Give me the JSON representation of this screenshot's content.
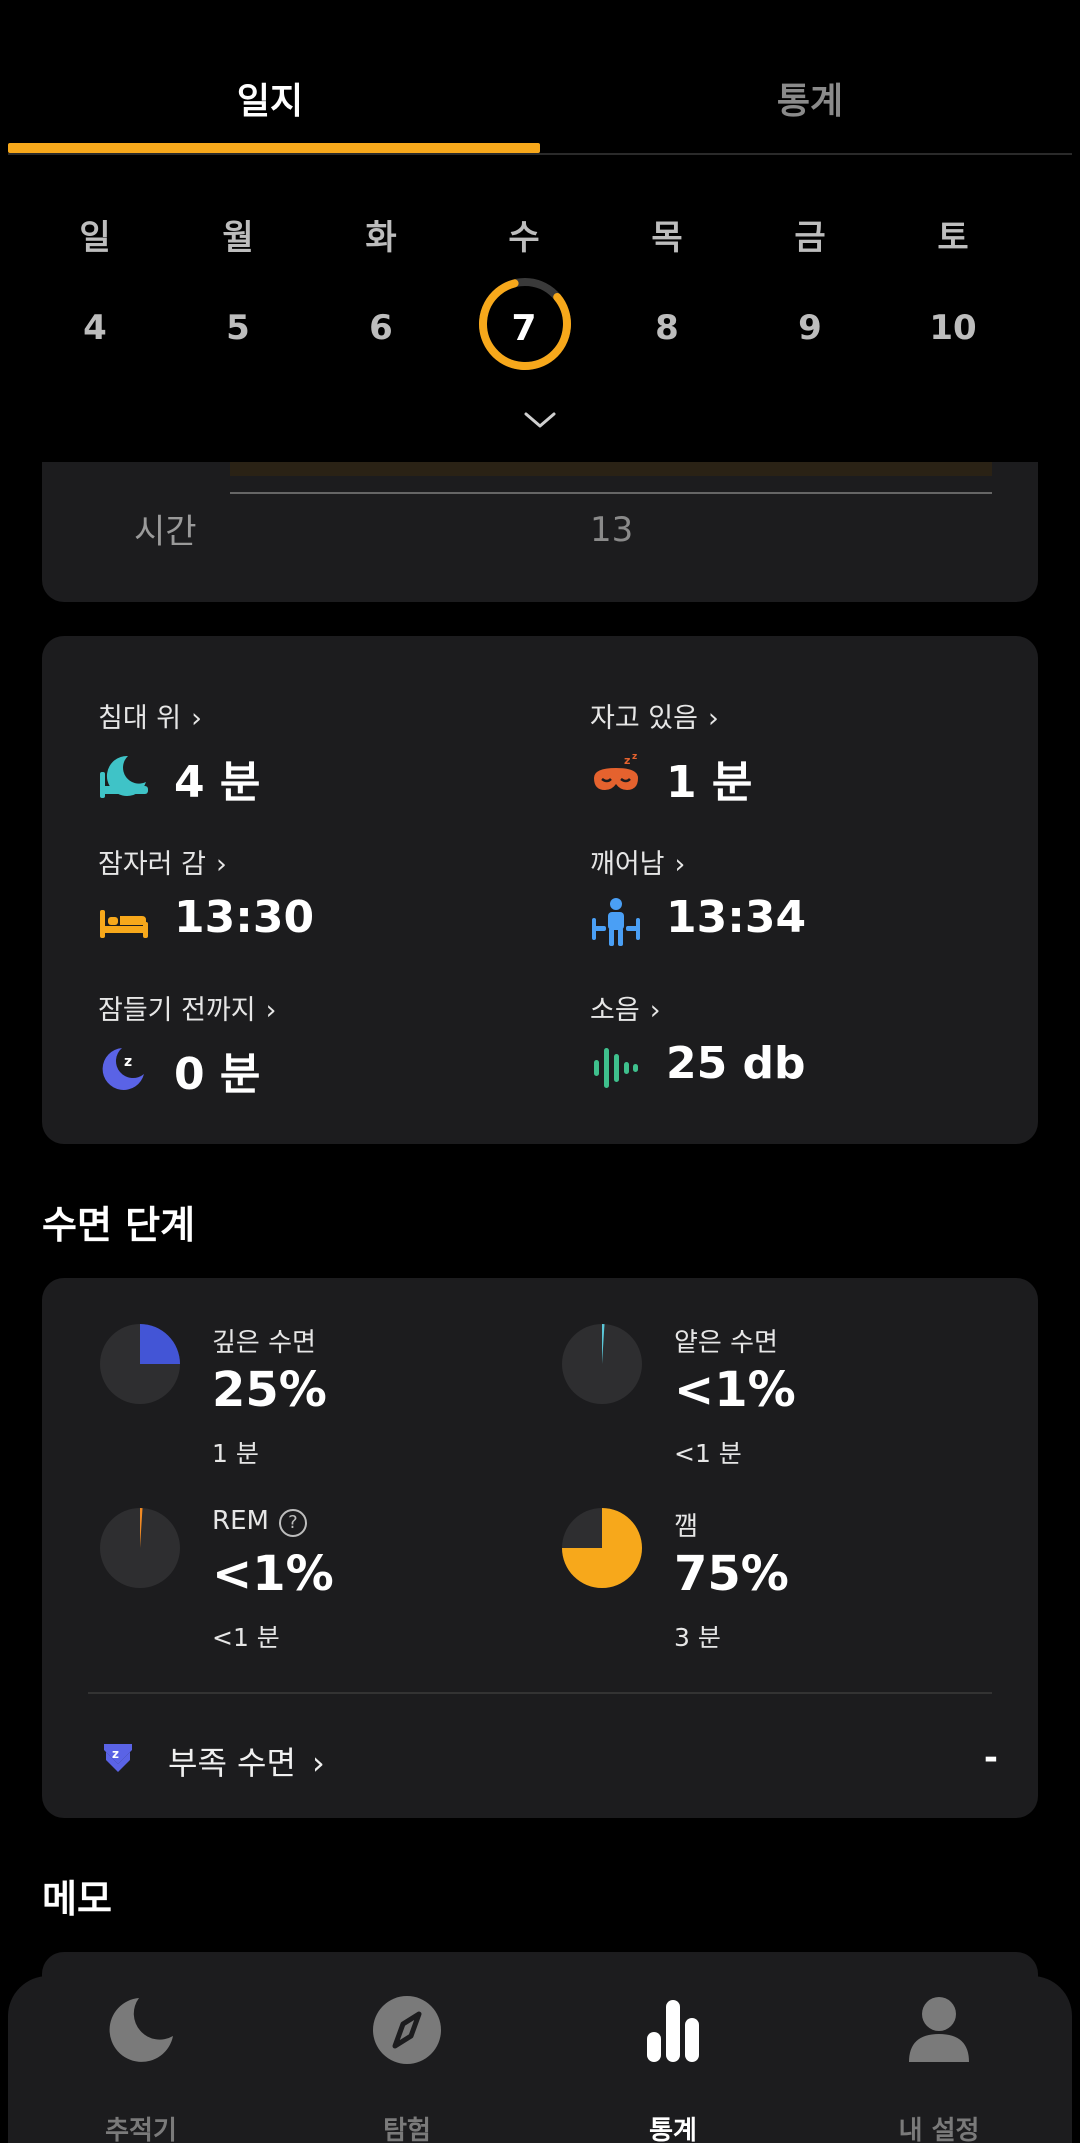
{
  "tabs": {
    "journal": "일지",
    "stats": "통계"
  },
  "week": {
    "days": [
      "일",
      "월",
      "화",
      "수",
      "목",
      "금",
      "토"
    ],
    "dates": [
      "4",
      "5",
      "6",
      "7",
      "8",
      "9",
      "10"
    ],
    "selected_index": 3,
    "selected_progress": 0.82
  },
  "timeline": {
    "label": "시간",
    "tick": "13"
  },
  "metrics": {
    "in_bed": {
      "label": "침대 위",
      "value": "4 분"
    },
    "asleep": {
      "label": "자고 있음",
      "value": "1 분"
    },
    "went_to_bed": {
      "label": "잠자러 감",
      "value": "13:30"
    },
    "woke_up": {
      "label": "깨어남",
      "value": "13:34"
    },
    "to_fall_asleep": {
      "label": "잠들기 전까지",
      "value": "0 분"
    },
    "noise": {
      "label": "소음",
      "value": "25 db"
    },
    "arrow": "›"
  },
  "stages": {
    "title": "수면 단계",
    "deep": {
      "name": "깊은 수면",
      "pct": "25%",
      "sub": "1 분",
      "fraction": 0.25,
      "color": "#4355D6"
    },
    "light": {
      "name": "얕은 수면",
      "pct": "<1%",
      "sub": "<1 분",
      "fraction": 0.01,
      "color": "#5BC8D9"
    },
    "rem": {
      "name": "REM",
      "pct": "<1%",
      "sub": "<1 분",
      "fraction": 0.01,
      "color": "#F08A24"
    },
    "awake": {
      "name": "깸",
      "pct": "75%",
      "sub": "3 분",
      "fraction": 0.75,
      "color": "#F7A81B"
    },
    "help": "?",
    "deficit": {
      "label": "부족 수면",
      "value": "-"
    }
  },
  "memo": {
    "title": "메모"
  },
  "nav": {
    "tracker": "추적기",
    "explore": "탐험",
    "stats": "통계",
    "settings": "내 설정"
  },
  "colors": {
    "accent": "#F7A81B",
    "card": "#1c1c1e",
    "bed_icon": "#F7A81B",
    "wake_icon": "#4A9FF5",
    "moon_icon": "#5A63E6",
    "noise_icon": "#3FC08D",
    "mask_icon": "#E5622E",
    "inbed_icon": "#3FC3C7"
  }
}
